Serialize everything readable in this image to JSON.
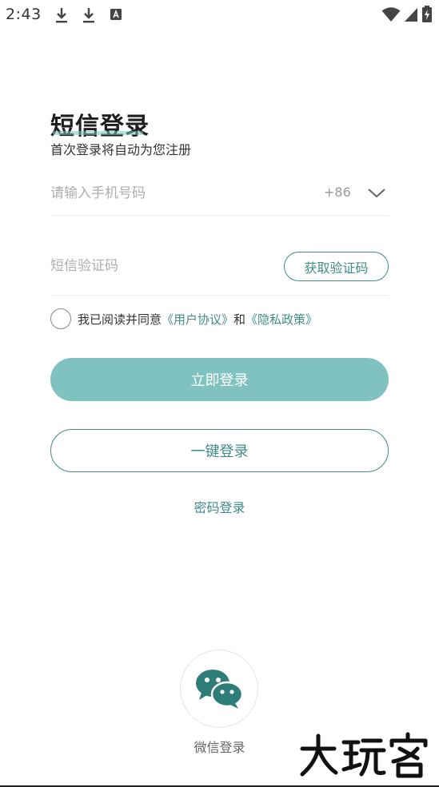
{
  "status_bar": {
    "time": "2:43",
    "left_icons": [
      "download-icon",
      "download-icon",
      "notification-icon"
    ],
    "right_icons": [
      "wifi-icon",
      "signal-icon",
      "battery-charging-icon"
    ]
  },
  "header": {
    "title": "短信登录",
    "subtitle": "首次登录将自动为您注册"
  },
  "form": {
    "phone_placeholder": "请输入手机号码",
    "phone_value": "",
    "country_code": "+86",
    "sms_placeholder": "短信验证码",
    "sms_value": "",
    "get_code_label": "获取验证码"
  },
  "agreement": {
    "checked": false,
    "prefix": "我已阅读并同意",
    "user_agreement": "《用户协议》",
    "conjunction": "和",
    "privacy_policy": "《隐私政策》"
  },
  "buttons": {
    "login_now": "立即登录",
    "one_click_login": "一键登录",
    "password_login": "密码登录"
  },
  "wechat": {
    "label": "微信登录"
  },
  "watermark": {
    "text": "大玩客"
  },
  "colors": {
    "accent": "#3f8c88",
    "primary_button": "#7fc2bf",
    "wechat_icon": "#2e7d78"
  }
}
